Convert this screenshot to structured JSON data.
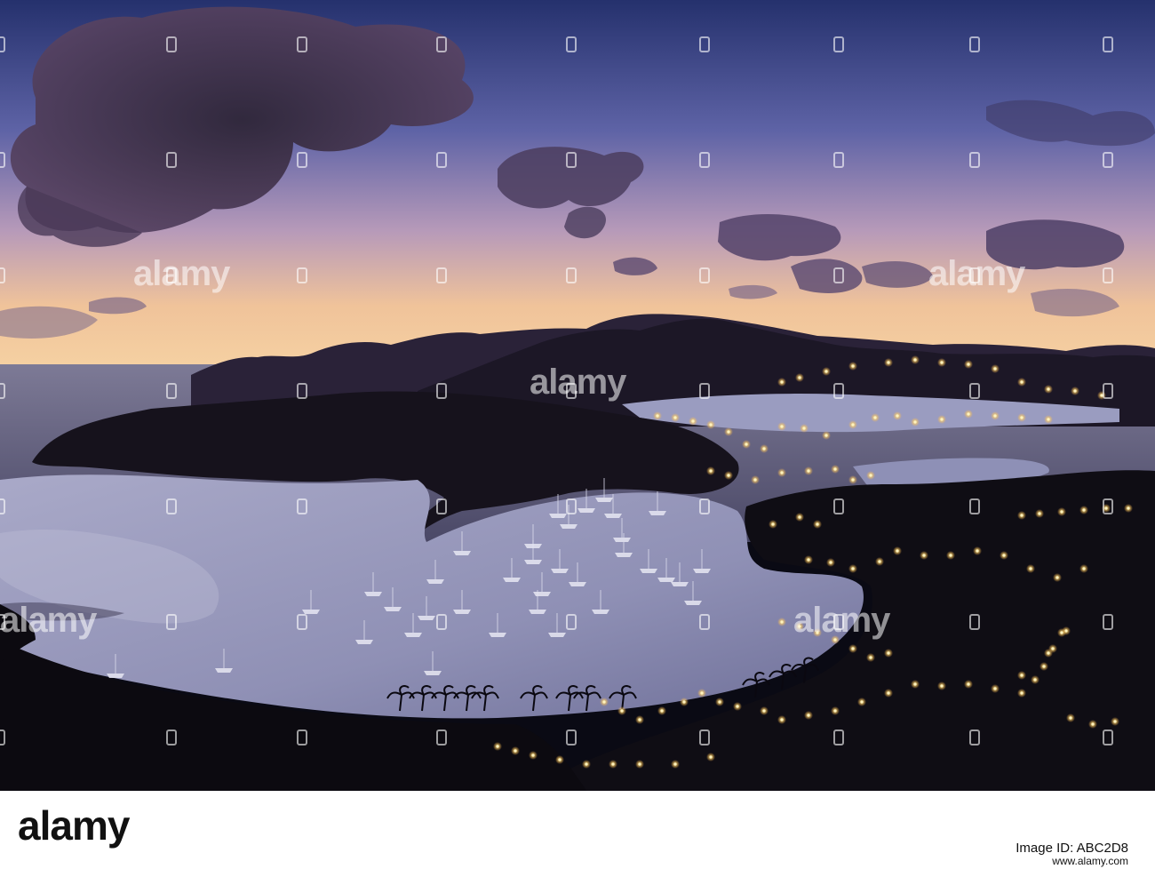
{
  "watermark": {
    "text": "alamy",
    "color": "#ffffff"
  },
  "footer": {
    "logo_text": "alamy",
    "image_id": "Image ID: ABC2D8",
    "site": "www.alamy.com"
  },
  "scene": {
    "subject": "harbour-at-dusk",
    "palette": {
      "sky_top": "#2c3a78",
      "sky_mid": "#8a7fbd",
      "sky_horizon": "#f3c28a",
      "cloud": "#3d2f4a",
      "hills": "#1b1624",
      "water": "#8f93b8",
      "light": "#ffd16a"
    }
  }
}
